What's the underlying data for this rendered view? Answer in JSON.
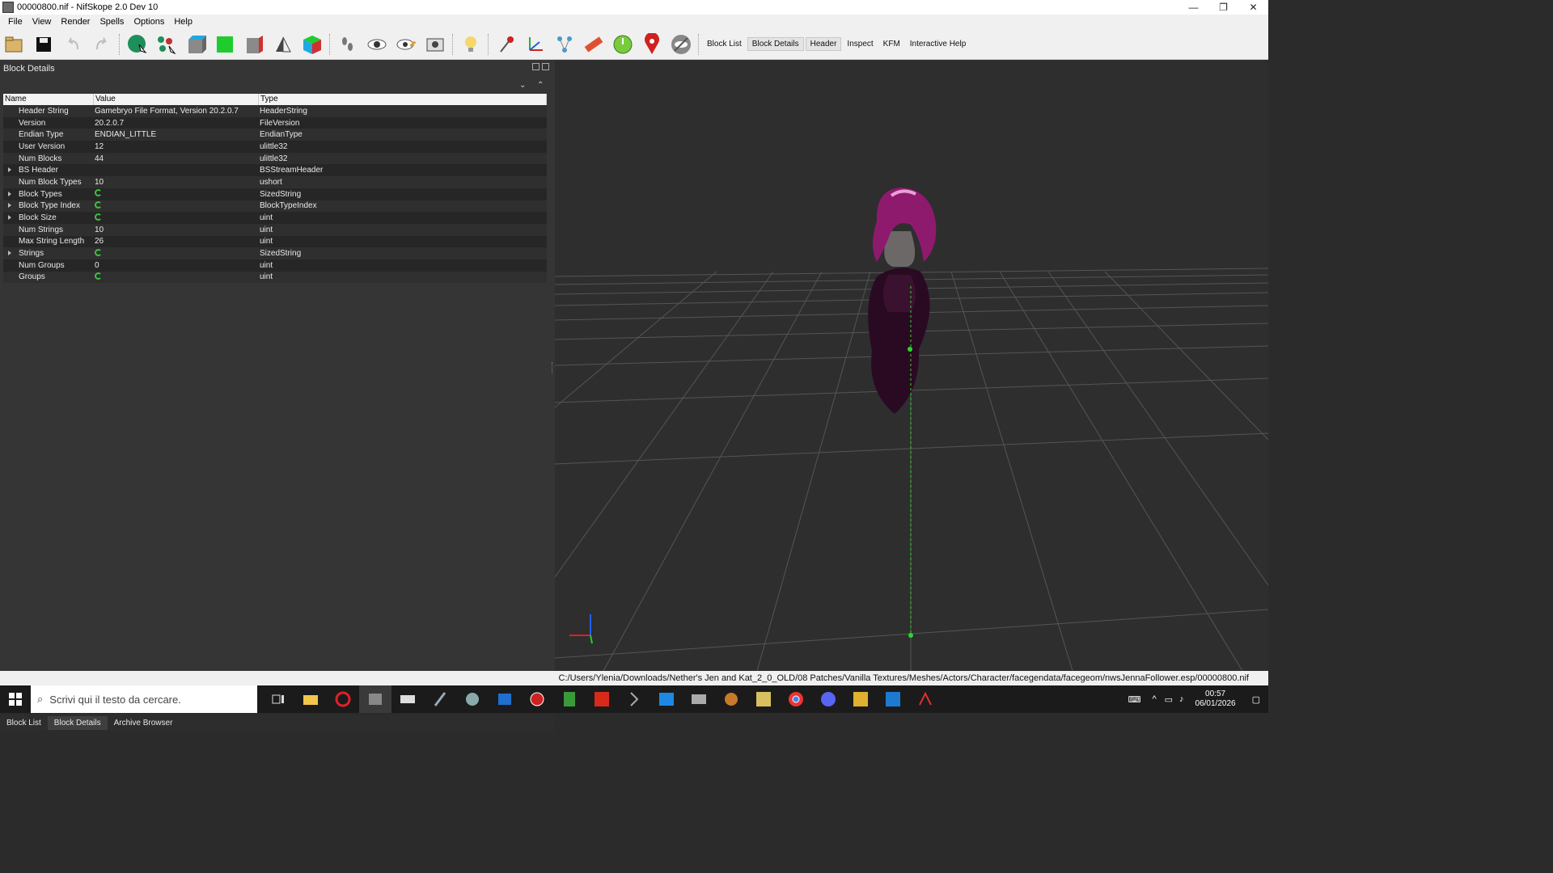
{
  "window": {
    "title": "00000800.nif - NifSkope 2.0 Dev 10",
    "min": "—",
    "max": "❐",
    "close": "✕"
  },
  "menu": [
    "File",
    "View",
    "Render",
    "Spells",
    "Options",
    "Help"
  ],
  "toolbar_tabs": [
    "Block List",
    "Block Details",
    "Header",
    "Inspect",
    "KFM",
    "Interactive Help"
  ],
  "panel": {
    "title": "Block Details",
    "columns": [
      "Name",
      "Value",
      "Type"
    ],
    "rows": [
      {
        "name": "Header String",
        "value": "Gamebryo File Format, Version 20.2.0.7",
        "type": "HeaderString",
        "expandable": false,
        "refresh": false
      },
      {
        "name": "Version",
        "value": "20.2.0.7",
        "type": "FileVersion",
        "expandable": false,
        "refresh": false
      },
      {
        "name": "Endian Type",
        "value": "ENDIAN_LITTLE",
        "type": "EndianType",
        "expandable": false,
        "refresh": false
      },
      {
        "name": "User Version",
        "value": "12",
        "type": "ulittle32",
        "expandable": false,
        "refresh": false
      },
      {
        "name": "Num Blocks",
        "value": "44",
        "type": "ulittle32",
        "expandable": false,
        "refresh": false
      },
      {
        "name": "BS Header",
        "value": "",
        "type": "BSStreamHeader",
        "expandable": true,
        "refresh": false
      },
      {
        "name": "Num Block Types",
        "value": "10",
        "type": "ushort",
        "expandable": false,
        "refresh": false
      },
      {
        "name": "Block Types",
        "value": "",
        "type": "SizedString",
        "expandable": true,
        "refresh": true
      },
      {
        "name": "Block Type Index",
        "value": "",
        "type": "BlockTypeIndex",
        "expandable": true,
        "refresh": true
      },
      {
        "name": "Block Size",
        "value": "",
        "type": "uint",
        "expandable": true,
        "refresh": true
      },
      {
        "name": "Num Strings",
        "value": "10",
        "type": "uint",
        "expandable": false,
        "refresh": false
      },
      {
        "name": "Max String Length",
        "value": "26",
        "type": "uint",
        "expandable": false,
        "refresh": false
      },
      {
        "name": "Strings",
        "value": "",
        "type": "SizedString",
        "expandable": true,
        "refresh": true
      },
      {
        "name": "Num Groups",
        "value": "0",
        "type": "uint",
        "expandable": false,
        "refresh": false
      },
      {
        "name": "Groups",
        "value": "",
        "type": "uint",
        "expandable": false,
        "refresh": true
      }
    ]
  },
  "bottom_tabs": [
    "Block List",
    "Block Details",
    "Archive Browser"
  ],
  "status_path": "C:/Users/Ylenia/Downloads/Nether's Jen and Kat_2_0_OLD/08 Patches/Vanilla Textures/Meshes/Actors/Character/facegendata/facegeom/nwsJennaFollower.esp/00000800.nif",
  "taskbar": {
    "search_placeholder": "Scrivi qui il testo da cercare.",
    "time": "00:57",
    "date": "06/01/2026"
  },
  "colors": {
    "panel_bg": "#353535",
    "viewport_bg": "#2e2e2e",
    "hair": "#8e1a6e",
    "axis_green": "#2fd52f"
  }
}
